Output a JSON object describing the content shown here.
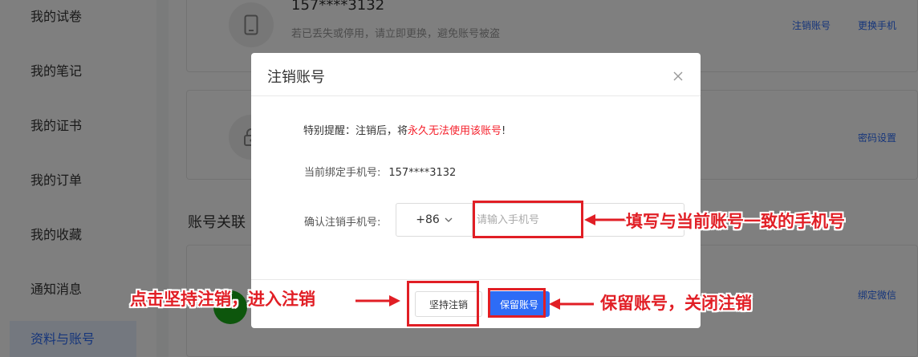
{
  "sidebar": {
    "items": [
      {
        "label": "我的试卷"
      },
      {
        "label": "我的笔记"
      },
      {
        "label": "我的证书"
      },
      {
        "label": "我的订单"
      },
      {
        "label": "我的收藏"
      },
      {
        "label": "通知消息"
      },
      {
        "label": "资料与账号"
      }
    ],
    "active_index": 6
  },
  "background": {
    "phone_card": {
      "phone": "157****3132",
      "tip": "若已丢失或停用，请立即更换，避免账号被盗",
      "cancel_link": "注销账号",
      "change_link": "更换手机"
    },
    "password_card": {
      "link": "密码设置"
    },
    "section_title": "账号关联",
    "wechat_card": {
      "link": "绑定微信"
    }
  },
  "modal": {
    "title": "注销账号",
    "warning_prefix": "特别提醒：注销后，将",
    "warning_emphasis": "永久无法使用该账号",
    "warning_suffix": "!",
    "bound_label": "当前绑定手机号:",
    "bound_value": "157****3132",
    "confirm_label": "确认注销手机号:",
    "country_code": "+86",
    "phone_placeholder": "请输入手机号",
    "insist_button": "坚持注销",
    "keep_button": "保留账号"
  },
  "annotations": {
    "input_note": "填写与当前账号一致的手机号",
    "insist_note": "点击坚持注销，进入注销",
    "keep_note": "保留账号，关闭注销"
  },
  "colors": {
    "accent": "#2d6cf6",
    "warning": "#f5222d",
    "annotation": "#e11e25",
    "overlay": "rgba(0,0,0,0.5)"
  },
  "icons": {
    "close": "close-icon",
    "dropdown": "chevron-down-icon",
    "phone": "phone-icon",
    "lock": "lock-icon",
    "wechat": "wechat-icon"
  }
}
